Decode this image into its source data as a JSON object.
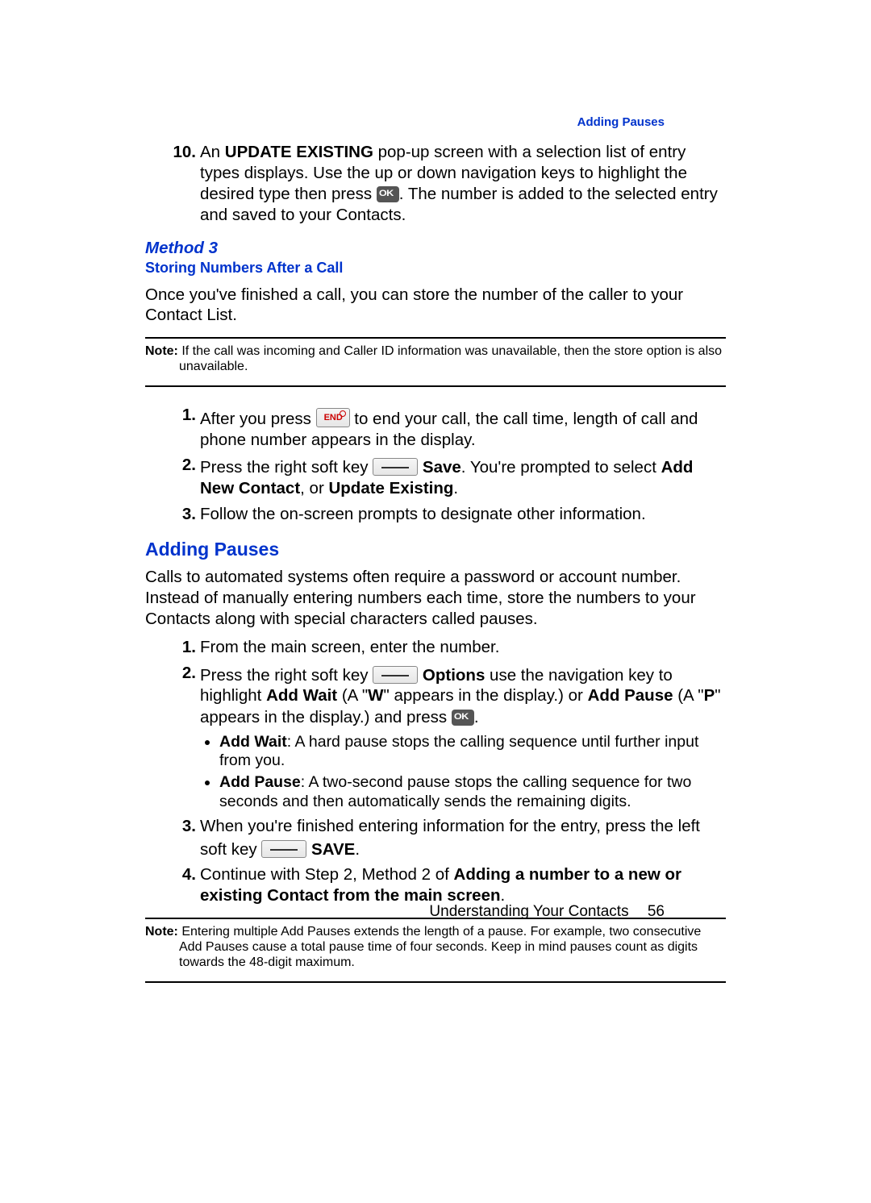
{
  "running_head": "Adding Pauses",
  "step10": {
    "num": "10.",
    "t1": "An ",
    "bold1": "UPDATE EXISTING",
    "t2": " pop-up screen with a selection list of entry types displays. Use the up or down navigation keys to highlight the desired type then press ",
    "t3": ". The number is added to the selected entry and saved to your Contacts."
  },
  "method3_h": "Method 3",
  "method3_sub": "Storing Numbers After a Call",
  "method3_intro": "Once you've finished a call, you can store the number of the caller to your Contact List.",
  "note1": {
    "label": "Note: ",
    "text": "If the call was incoming and Caller ID information was unavailable, then the store option is also unavailable."
  },
  "m3_steps": {
    "s1": {
      "num": "1.",
      "t1": "After you press ",
      "t2": " to end your call, the call time, length of call and phone number appears in the display."
    },
    "s2": {
      "num": "2.",
      "t1": "Press the right soft key ",
      "t2": " ",
      "bold1": "Save",
      "t3": ". You're prompted to select ",
      "bold2": "Add New Contact",
      "t4": ", or ",
      "bold3": "Update Existing",
      "t5": "."
    },
    "s3": {
      "num": "3.",
      "t1": "Follow the on-screen prompts to designate other information."
    }
  },
  "adding_h": "Adding Pauses",
  "adding_intro": "Calls to automated systems often require a password or account number. Instead of manually entering numbers each time, store the numbers to your Contacts along with special characters called pauses.",
  "ap_steps": {
    "s1": {
      "num": "1.",
      "t1": "From the main screen, enter the number."
    },
    "s2": {
      "num": "2.",
      "t1": "Press the right soft key ",
      "t2": " ",
      "bold1": "Options",
      "t3": " use the navigation key to highlight ",
      "bold2": "Add Wait",
      "t4": " (A \"",
      "bold3": "W",
      "t5": "\" appears in the display.) or ",
      "bold4": "Add Pause",
      "t6": " (A \"",
      "bold5": "P",
      "t7": "\" appears in the display.) and press ",
      "t8": "."
    },
    "b1": {
      "bold": "Add Wait",
      "text": ": A hard pause stops the calling sequence until further input from you."
    },
    "b2": {
      "bold": "Add Pause",
      "text": ": A two-second pause stops the calling sequence for two seconds and then automatically sends the remaining digits."
    },
    "s3": {
      "num": "3.",
      "t1": "When you're finished entering information for the entry, press the left soft key ",
      "t2": " ",
      "bold1": "SAVE",
      "t3": "."
    },
    "s4": {
      "num": "4.",
      "t1": "Continue with Step 2, Method 2 of ",
      "bold1": "Adding a number to a new or existing Contact from the main screen",
      "t2": "."
    }
  },
  "note2": {
    "label": "Note: ",
    "text": "Entering multiple Add Pauses extends the length of a pause. For example, two consecutive Add Pauses cause a total pause time of four seconds. Keep in mind pauses count as digits towards the 48-digit maximum."
  },
  "footer": {
    "chapter": "Understanding Your Contacts",
    "page": "56"
  }
}
